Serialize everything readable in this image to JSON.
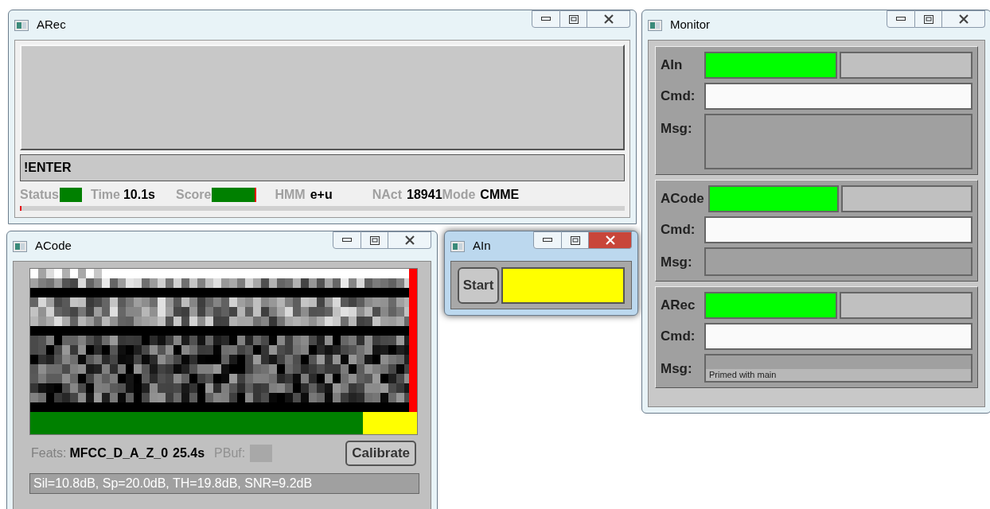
{
  "arec": {
    "title": "ARec",
    "active": false,
    "input": "!ENTER",
    "status": {
      "label": "Status",
      "color": "#008000"
    },
    "time": {
      "label": "Time",
      "value": "10.1s"
    },
    "score": {
      "label": "Score"
    },
    "hmm": {
      "label": "HMM",
      "value": "e+u"
    },
    "nact": {
      "label": "NAct",
      "value": "18941"
    },
    "mode": {
      "label": "Mode",
      "value": "CMME"
    },
    "progress": {
      "level": 0.003
    }
  },
  "acode": {
    "title": "ACode",
    "active": false,
    "buffer": {
      "level": 0.86
    },
    "feats_label": "Feats:",
    "feats_value": "MFCC_D_A_Z_0",
    "duration": "25.4s",
    "pbuf_label": "PBuf:",
    "calibrate": "Calibrate",
    "stats": "Sil=10.8dB, Sp=20.0dB, TH=19.8dB, SNR=9.2dB"
  },
  "ain": {
    "title": "AIn",
    "active": true,
    "start": "Start",
    "indicator": {
      "color": "#ffff00"
    }
  },
  "monitor": {
    "title": "Monitor",
    "active": false,
    "sections": [
      {
        "name": "AIn",
        "color": "#00ff00",
        "cmd_label": "Cmd:",
        "msg_label": "Msg:",
        "tall": true
      },
      {
        "name": "ACode",
        "color": "#00ff00",
        "cmd_label": "Cmd:",
        "msg_label": "Msg:",
        "tall": false
      },
      {
        "name": "ARec",
        "color": "#00ff00",
        "cmd_label": "Cmd:",
        "msg_label": "Msg:",
        "tall": false,
        "msg": "Primed with main"
      }
    ]
  }
}
